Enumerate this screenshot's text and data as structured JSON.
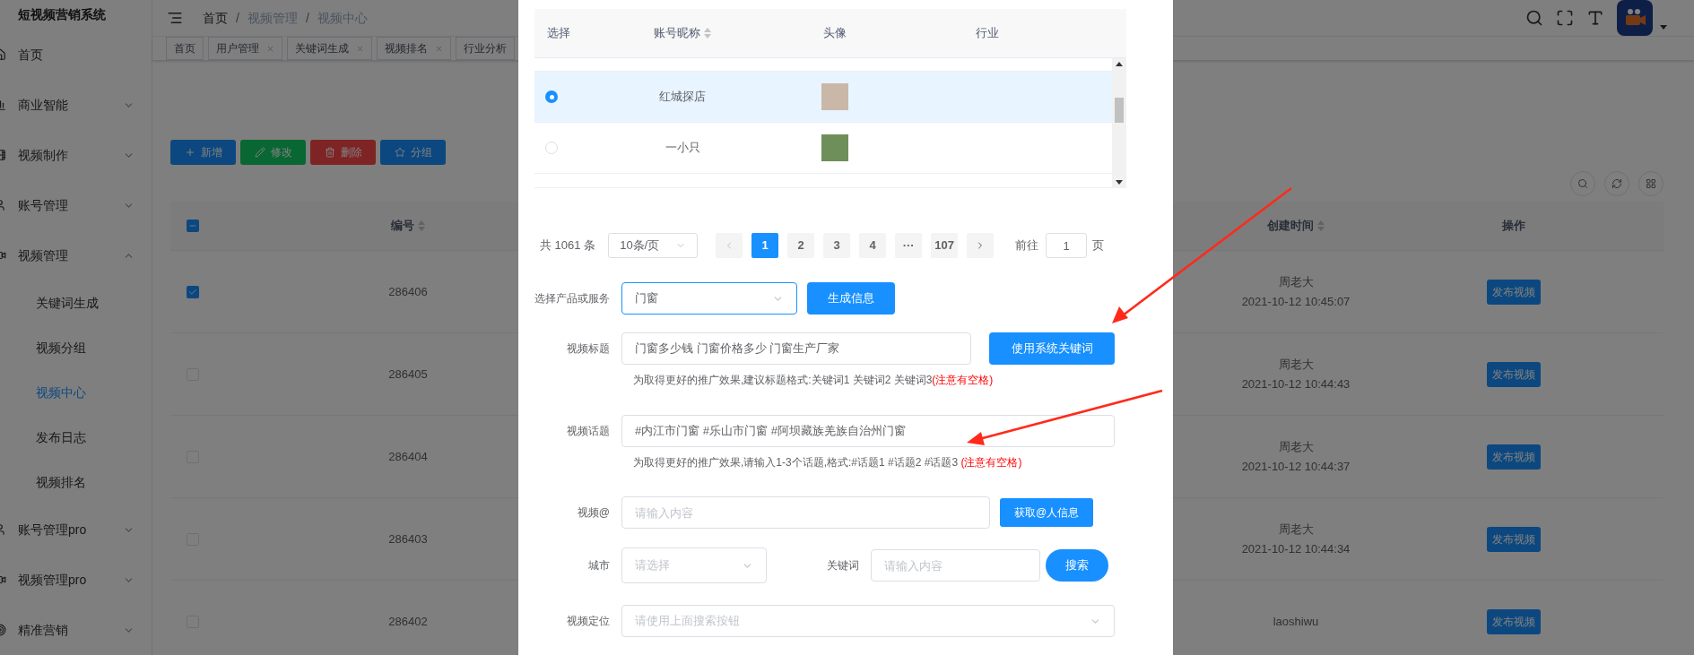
{
  "sidebar": {
    "title": "短视频营销系统",
    "items": [
      {
        "label": "首页"
      },
      {
        "label": "商业智能",
        "expanded": false
      },
      {
        "label": "视频制作",
        "expanded": false
      },
      {
        "label": "账号管理",
        "expanded": false
      },
      {
        "label": "视频管理",
        "expanded": true,
        "children": [
          {
            "label": "关键词生成",
            "selected": false
          },
          {
            "label": "视频分组",
            "selected": false
          },
          {
            "label": "视频中心",
            "selected": true
          },
          {
            "label": "发布日志",
            "selected": false
          },
          {
            "label": "视频排名",
            "selected": false
          }
        ]
      },
      {
        "label": "账号管理pro",
        "expanded": false
      },
      {
        "label": "视频管理pro",
        "expanded": false
      },
      {
        "label": "精准营销",
        "expanded": false
      }
    ]
  },
  "header": {
    "breadcrumb": [
      "首页",
      "视频管理",
      "视频中心"
    ],
    "separator": "/"
  },
  "tabs": [
    {
      "label": "首页",
      "closable": false
    },
    {
      "label": "用户管理",
      "closable": true
    },
    {
      "label": "关键词生成",
      "closable": true
    },
    {
      "label": "视频排名",
      "closable": true
    },
    {
      "label": "行业分析",
      "closable": false
    }
  ],
  "toolbar": {
    "buttons": [
      {
        "label": "新增",
        "kind": "add"
      },
      {
        "label": "修改",
        "kind": "edit"
      },
      {
        "label": "删除",
        "kind": "delete"
      },
      {
        "label": "分组",
        "kind": "group"
      }
    ]
  },
  "table": {
    "select_all_partial": true,
    "columns": [
      {
        "label": "编号",
        "sortable": true
      },
      {
        "label": "创建时间",
        "sortable": true
      },
      {
        "label": "操作",
        "sortable": false
      }
    ],
    "rows": [
      {
        "checked": true,
        "id": "286406",
        "creator": "周老大",
        "created": "2021-10-12 10:45:07",
        "action": "发布视频"
      },
      {
        "checked": false,
        "id": "286405",
        "creator": "周老大",
        "created": "2021-10-12 10:44:43",
        "action": "发布视频"
      },
      {
        "checked": false,
        "id": "286404",
        "creator": "周老大",
        "created": "2021-10-12 10:44:37",
        "action": "发布视频"
      },
      {
        "checked": false,
        "id": "286403",
        "creator": "周老大",
        "created": "2021-10-12 10:44:34",
        "action": "发布视频"
      },
      {
        "checked": false,
        "id": "286402",
        "creator": "laoshiwu",
        "action": "发布视频"
      }
    ]
  },
  "dialog": {
    "account_table": {
      "columns": [
        {
          "label": "选择",
          "sortable": false
        },
        {
          "label": "账号昵称",
          "sortable": true
        },
        {
          "label": "头像",
          "sortable": false
        },
        {
          "label": "行业",
          "sortable": false
        }
      ],
      "rows": [
        {
          "selected": true,
          "nickname": "红城探店"
        },
        {
          "selected": false,
          "nickname": "一小只"
        }
      ]
    },
    "pagination": {
      "total": "共 1061 条",
      "page_size": "10条/页",
      "pages": [
        {
          "label": "1",
          "selected": true
        },
        {
          "label": "2",
          "selected": false
        },
        {
          "label": "3",
          "selected": false
        },
        {
          "label": "4",
          "selected": false
        },
        {
          "label": "···",
          "selected": false
        },
        {
          "label": "107",
          "selected": false
        }
      ],
      "goto_label": "前往",
      "goto_value": "1",
      "goto_suffix": "页"
    },
    "product": {
      "label": "选择产品或服务",
      "value": "门窗",
      "button": "生成信息"
    },
    "title": {
      "label": "视频标题",
      "value": "门窗多少钱 门窗价格多少 门窗生产厂家",
      "button": "使用系统关键词",
      "hint": "为取得更好的推广效果,建议标题格式:关键词1 关键词2 关键词3",
      "hint_warning": "(注意有空格)"
    },
    "topic": {
      "label": "视频话题",
      "value": "#内江市门窗 #乐山市门窗 #阿坝藏族羌族自治州门窗",
      "hint": "为取得更好的推广效果,请输入1-3个话题,格式:#话题1 #话题2 #话题3 ",
      "hint_warning": "(注意有空格)"
    },
    "mention": {
      "label": "视频@",
      "placeholder": "请输入内容",
      "button": "获取@人信息"
    },
    "city": {
      "label": "城市",
      "placeholder": "请选择"
    },
    "keyword": {
      "label": "关键词",
      "placeholder": "请输入内容",
      "button": "搜索"
    },
    "location": {
      "label": "视频定位",
      "placeholder": "请使用上面搜索按钮"
    }
  }
}
